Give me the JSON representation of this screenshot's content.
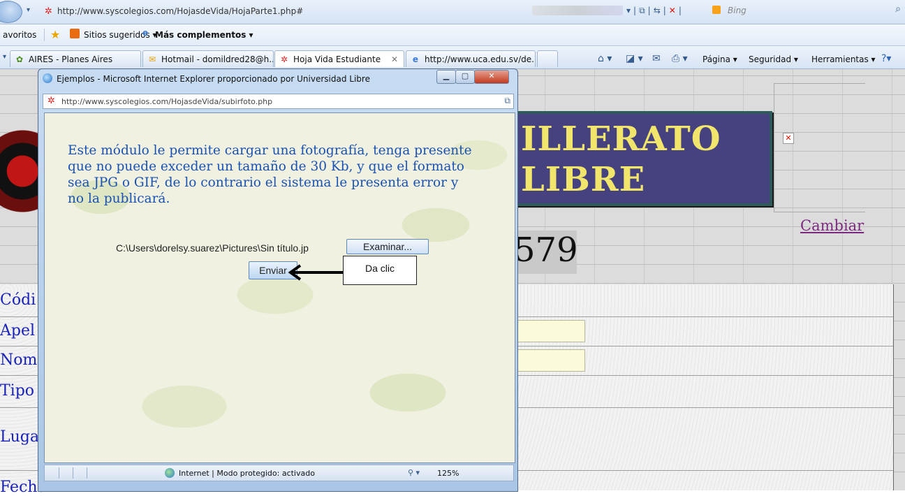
{
  "browser": {
    "url": "http://www.syscolegios.com/HojasdeVida/HojaParte1.php#",
    "search_placeholder": "Bing",
    "favorites": {
      "label": "avoritos",
      "suggested": "Sitios sugeridos ▾",
      "addons": "Más complementos ▾"
    },
    "tabs": [
      {
        "label": "AIRES - Planes Aires",
        "icon": "aires-icon"
      },
      {
        "label": "Hotmail - domildred28@h...",
        "icon": "hotmail-icon"
      },
      {
        "label": "Hoja Vida Estudiante",
        "icon": "syscolegios-icon",
        "active": true
      },
      {
        "label": "http://www.uca.edu.sv/de...",
        "icon": "ie-icon"
      }
    ],
    "commands": {
      "page": "Página ▾",
      "security": "Seguridad ▾",
      "tools": "Herramientas ▾"
    }
  },
  "page": {
    "banner_line1": "ILLERATO",
    "banner_line2": "LIBRE",
    "number": "579",
    "change_link": "Cambiar",
    "form_labels": [
      "Códi",
      "Apel",
      "Nom",
      "Tipo",
      "Luga",
      "Fecha"
    ]
  },
  "popup": {
    "title": "Ejemplos - Microsoft Internet Explorer proporcionado por Universidad Libre",
    "url": "http://www.syscolegios.com/HojasdeVida/subirfoto.php",
    "message": "Este módulo le permite cargar una fotografía, tenga presente que no puede exceder un tamaño de 30 Kb, y que el formato sea JPG o GIF, de lo contrario el sistema le presenta error y no la publicará.",
    "file_path": "C:\\Users\\dorelsy.suarez\\Pictures\\Sin título.jp",
    "browse_button": "Examinar...",
    "send_button": "Enviar",
    "callout": "Da clic",
    "status": "Internet | Modo protegido: activado",
    "zoom": "125%"
  },
  "colors": {
    "banner_bg": "#45427f",
    "banner_text": "#f2e56c",
    "link": "#7b2a7f",
    "form_label": "#1a22b8",
    "popup_text": "#1a52b3"
  }
}
